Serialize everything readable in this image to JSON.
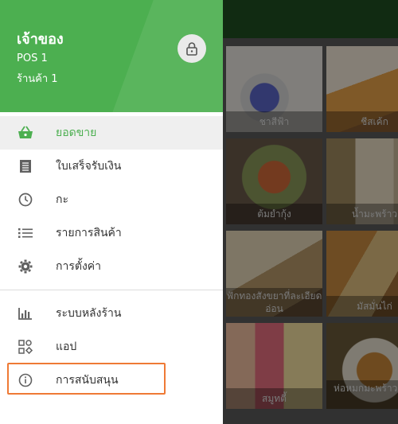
{
  "drawer": {
    "owner": "เจ้าของ",
    "pos": "POS 1",
    "store": "ร้านค้า 1",
    "lock_icon": "lock-icon",
    "menu": [
      {
        "label": "ยอดขาย",
        "icon": "basket-icon",
        "active": true
      },
      {
        "label": "ใบเสร็จรับเงิน",
        "icon": "receipt-icon"
      },
      {
        "label": "กะ",
        "icon": "clock-icon"
      },
      {
        "label": "รายการสินค้า",
        "icon": "list-icon"
      },
      {
        "label": "การตั้งค่า",
        "icon": "gear-icon"
      }
    ],
    "menu2": [
      {
        "label": "ระบบหลังร้าน",
        "icon": "bar-chart-icon"
      },
      {
        "label": "แอป",
        "icon": "apps-icon"
      },
      {
        "label": "การสนับสนุน",
        "icon": "info-icon"
      }
    ]
  },
  "products": [
    {
      "name": "ชาสีฟ้า"
    },
    {
      "name": "ชีสเค้ก"
    },
    {
      "name": "ต้มยำกุ้ง"
    },
    {
      "name": "น้ำมะพร้าว"
    },
    {
      "name": "ฟักทองสังขยาที่ละเอียดอ่อน"
    },
    {
      "name": "มัสมั่นไก่"
    },
    {
      "name": "สมูทตี้"
    },
    {
      "name": "ห่อหมกมะพร้าวอ่อน"
    }
  ],
  "colors": {
    "accent": "#4caf50",
    "highlight": "#ef7a35"
  }
}
